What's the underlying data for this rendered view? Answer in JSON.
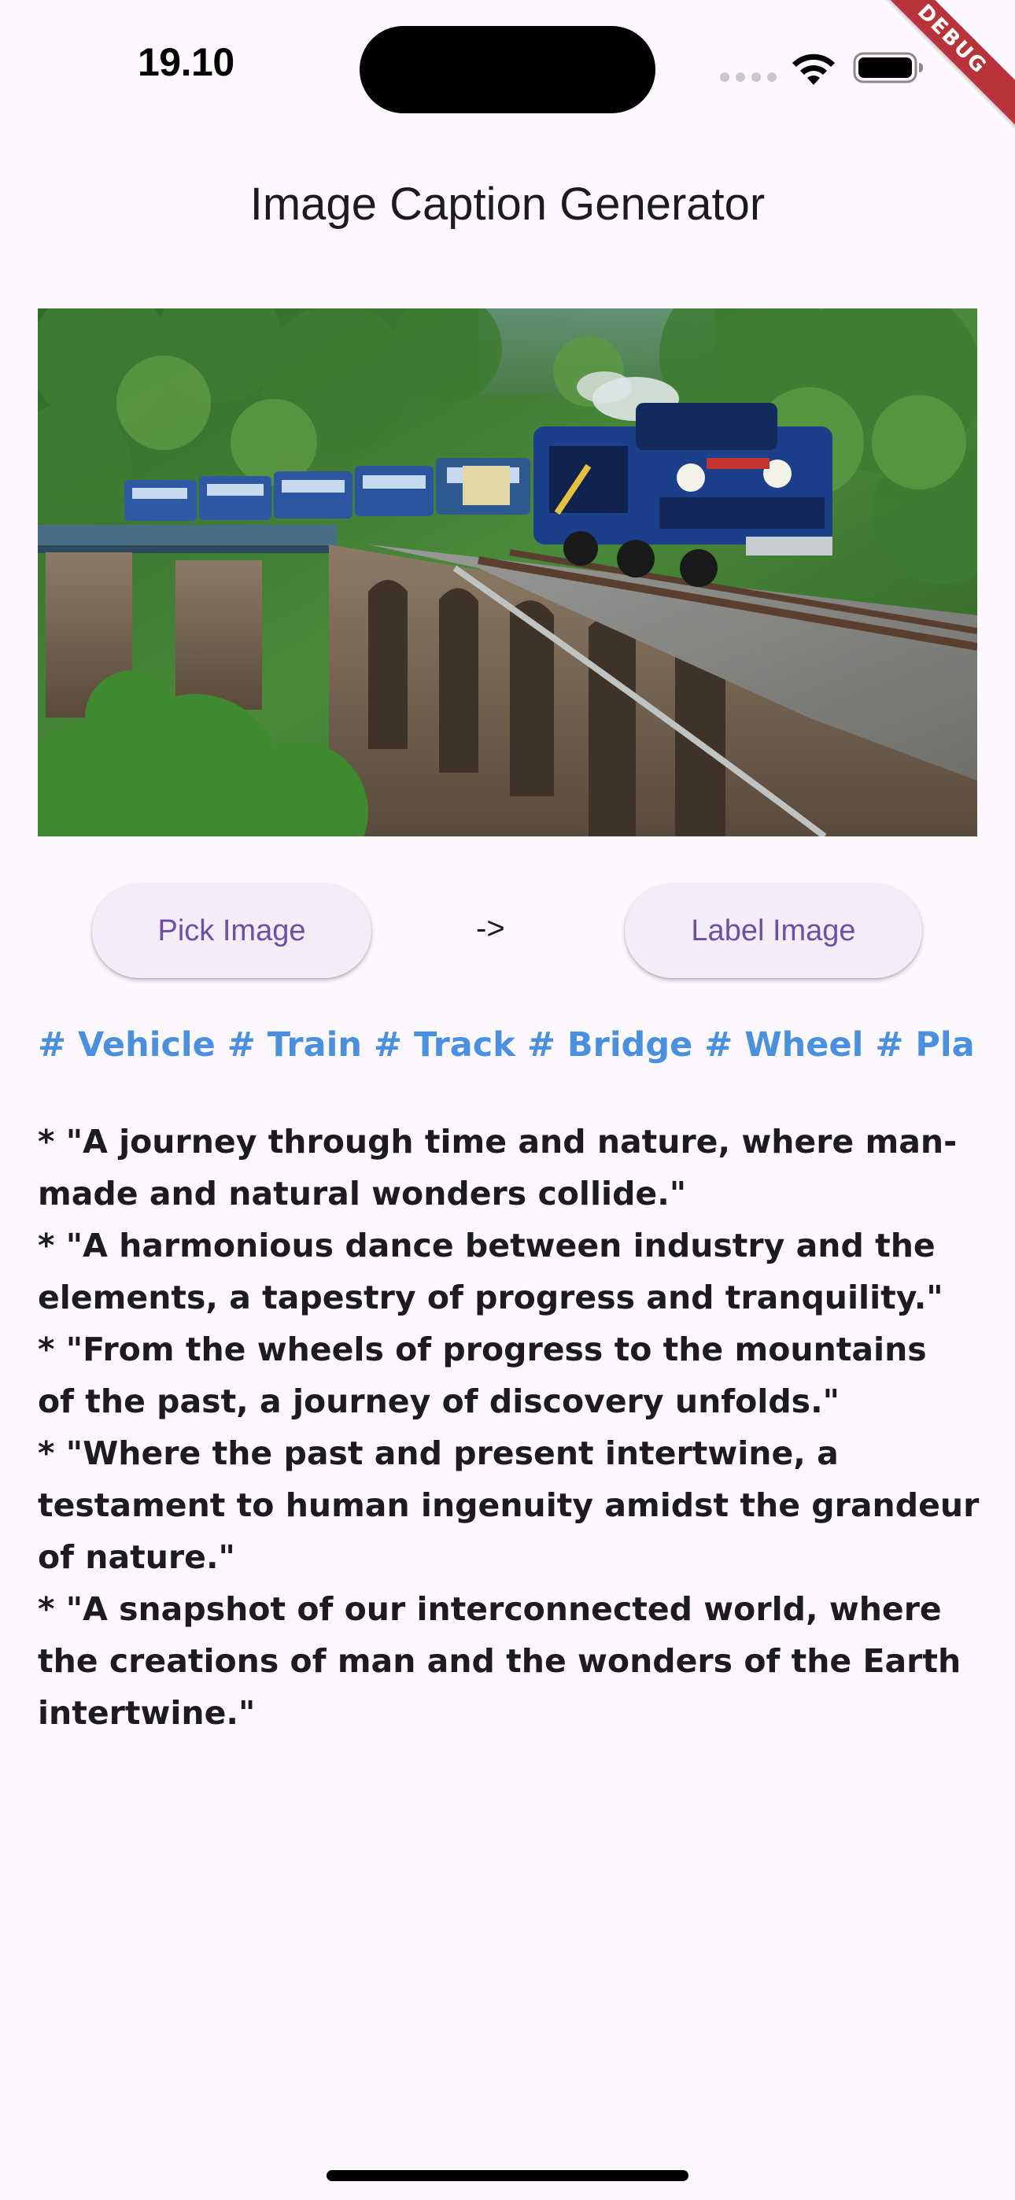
{
  "status_bar": {
    "time": "19.10",
    "debug_label": "DEBUG"
  },
  "app_bar": {
    "title": "Image Caption Generator"
  },
  "photo": {
    "subject": "blue steam train crossing stone arch bridge in forest"
  },
  "actions": {
    "pick_label": "Pick Image",
    "arrow": "->",
    "label_label": "Label Image"
  },
  "tags": {
    "text": "# Vehicle # Train # Track # Bridge # Wheel # Plant #"
  },
  "captions": {
    "lines": [
      "* \"A journey through time and nature, where man-",
      "made and natural wonders collide.\"",
      "* \"A harmonious dance between industry and the",
      "elements, a tapestry of progress and tranquility.\"",
      "* \"From the wheels of progress to the mountains",
      "of the past, a journey of discovery unfolds.\"",
      "* \"Where the past and present intertwine, a",
      "testament to human ingenuity amidst the grandeur",
      "of nature.\"",
      "* \"A snapshot of our interconnected world, where",
      "the creations of man and the wonders of the Earth",
      "intertwine.\""
    ]
  },
  "colors": {
    "background": "#fdf8fd",
    "button_bg": "#f3edf7",
    "button_text": "#6b4fa8",
    "tag_text": "#4a90e2",
    "debug_banner": "#b8343a"
  },
  "icons": [
    "wifi-icon",
    "battery-icon",
    "cellular-signal-icon"
  ]
}
